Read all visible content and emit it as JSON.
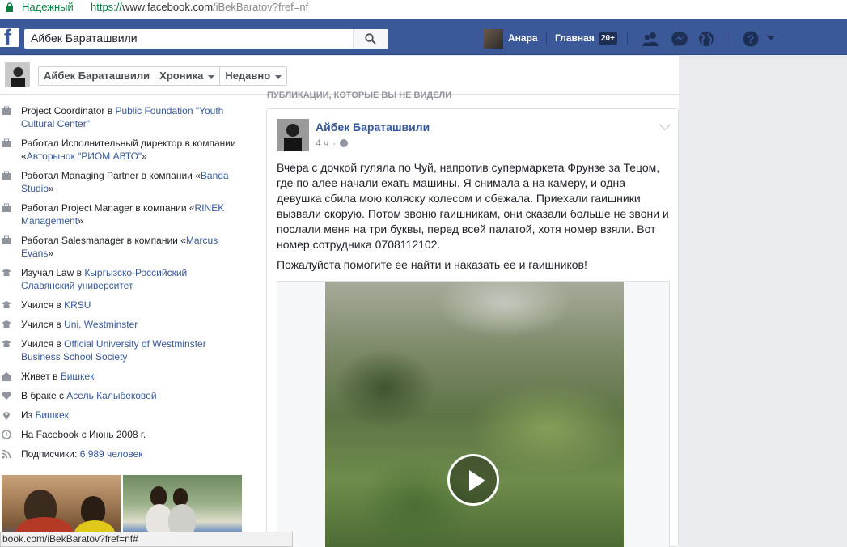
{
  "browser": {
    "secure_label": "Надежный",
    "url_scheme": "https://",
    "url_host": "www.facebook.com",
    "url_path": "/iBekBaratov?fref=nf",
    "status_url": "book.com/iBekBaratov?fref=nf#"
  },
  "topbar": {
    "logo": "f",
    "search_value": "Айбек Бараташвили",
    "user_name": "Анара",
    "home_label": "Главная",
    "home_badge": "20+",
    "icons": [
      "friends-icon",
      "messenger-icon",
      "globe-icon",
      "help-icon",
      "caret-down-icon"
    ]
  },
  "profile_strip": {
    "name": "Айбек Бараташвили",
    "timeline_label": "Хроника",
    "recent_label": "Недавно"
  },
  "intro": [
    {
      "icon": "briefcase-icon",
      "parts": [
        {
          "t": "Project Coordinator в "
        },
        {
          "t": "Public Foundation \"Youth Cultural Center\"",
          "link": true
        }
      ]
    },
    {
      "icon": "briefcase-icon",
      "parts": [
        {
          "t": "Работал Исполнительный директор в компании «"
        },
        {
          "t": "Авторынок \"РИОМ АВТО\"",
          "link": true
        },
        {
          "t": "»"
        }
      ]
    },
    {
      "icon": "briefcase-icon",
      "parts": [
        {
          "t": "Работал Managing Partner в компании «"
        },
        {
          "t": "Banda Studio",
          "link": true
        },
        {
          "t": "»"
        }
      ]
    },
    {
      "icon": "briefcase-icon",
      "parts": [
        {
          "t": "Работал Project Manager в компании «"
        },
        {
          "t": "RINEK Management",
          "link": true
        },
        {
          "t": "»"
        }
      ]
    },
    {
      "icon": "briefcase-icon",
      "parts": [
        {
          "t": "Работал Salesmanager в компании «"
        },
        {
          "t": "Marcus Evans",
          "link": true
        },
        {
          "t": "»"
        }
      ]
    },
    {
      "icon": "graduation-cap-icon",
      "parts": [
        {
          "t": "Изучал Law в "
        },
        {
          "t": "Кыргызско-Российский Славянский университет",
          "link": true
        }
      ]
    },
    {
      "icon": "graduation-cap-icon",
      "parts": [
        {
          "t": "Учился в "
        },
        {
          "t": "KRSU",
          "link": true
        }
      ]
    },
    {
      "icon": "graduation-cap-icon",
      "parts": [
        {
          "t": "Учился в "
        },
        {
          "t": "Uni. Westminster",
          "link": true
        }
      ]
    },
    {
      "icon": "graduation-cap-icon",
      "parts": [
        {
          "t": "Учился в "
        },
        {
          "t": "Official University of Westminster Business School Society",
          "link": true
        }
      ]
    },
    {
      "icon": "home-icon",
      "parts": [
        {
          "t": "Живет в "
        },
        {
          "t": "Бишкек",
          "link": true
        }
      ]
    },
    {
      "icon": "heart-icon",
      "parts": [
        {
          "t": "В браке с "
        },
        {
          "t": "Асель Калыбековой",
          "link": true
        }
      ]
    },
    {
      "icon": "location-pin-icon",
      "parts": [
        {
          "t": "Из "
        },
        {
          "t": "Бишкек",
          "link": true
        }
      ]
    },
    {
      "icon": "clock-icon",
      "parts": [
        {
          "t": "На Facebook с Июнь 2008 г."
        }
      ]
    },
    {
      "icon": "rss-icon",
      "parts": [
        {
          "t": "Подписчики: "
        },
        {
          "t": "6 989 человек",
          "link": true
        }
      ]
    }
  ],
  "feed": {
    "section_header": "ПУБЛИКАЦИИ, КОТОРЫЕ ВЫ НЕ ВИДЕЛИ",
    "post": {
      "author": "Айбек Бараташвили",
      "time": "4 ч",
      "paragraph1": "Вчера с дочкой гуляла по Чуй, напротив супермаркета Фрунзе за Тецом, где по алее начали ехать машины. Я снимала а на камеру, и одна девушка сбила мою коляску колесом и сбежала. Приехали гаишники вызвали скорую. Потом звоню гаишникам, они сказали больше не звони и послали меня на три буквы, перед всей палатой, хотя номер взяли. Вот номер сотрудника 0708112102.",
      "paragraph2": "Пожалуйста помогите ее найти и наказать ее и гаишников!"
    }
  },
  "colors": {
    "fb_blue": "#3b5998",
    "link": "#365899",
    "secure_green": "#0b8043"
  }
}
